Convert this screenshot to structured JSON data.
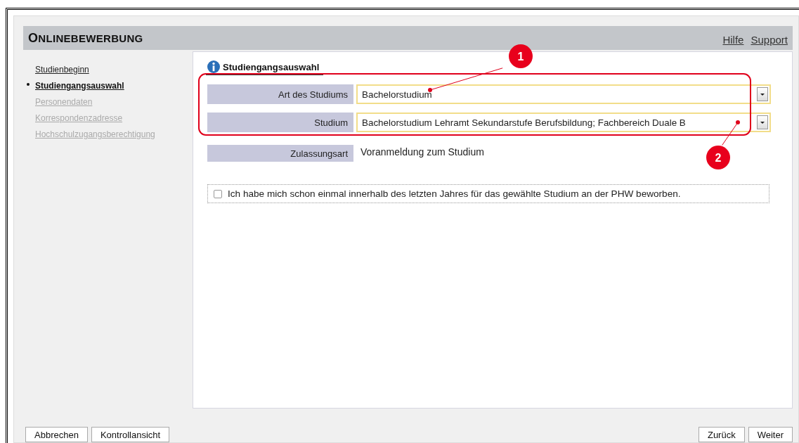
{
  "header": {
    "title": "ONLINEBEWERBUNG",
    "links": [
      "Hilfe",
      "Support"
    ]
  },
  "sidebar": {
    "items": [
      {
        "label": "Studienbeginn",
        "selected": false,
        "disabled": false
      },
      {
        "label": "Studiengangsauswahl",
        "selected": true,
        "disabled": false
      },
      {
        "label": "Personendaten",
        "selected": false,
        "disabled": true
      },
      {
        "label": "Korrespondenzadresse",
        "selected": false,
        "disabled": true
      },
      {
        "label": "Hochschulzugangsberechtigung",
        "selected": false,
        "disabled": true
      }
    ]
  },
  "section": {
    "title": "Studiengangsauswahl"
  },
  "fields": [
    {
      "kind": "select",
      "label": "Art des Studiums",
      "value": "Bachelorstudium"
    },
    {
      "kind": "select",
      "label": "Studium",
      "value": "Bachelorstudium Lehramt Sekundarstufe Berufsbildung; Fachbereich Duale B"
    },
    {
      "kind": "text",
      "label": "Zulassungsart",
      "value": "Voranmeldung zum Studium"
    }
  ],
  "checkbox": {
    "label": "Ich habe mich schon einmal innerhalb des letzten Jahres für das gewählte Studium an der PHW beworben.",
    "checked": false
  },
  "annotations": [
    "1",
    "2"
  ],
  "buttons_left": [
    "Abbrechen",
    "Kontrollansicht"
  ],
  "buttons_right": [
    "Zurück",
    "Weiter"
  ]
}
